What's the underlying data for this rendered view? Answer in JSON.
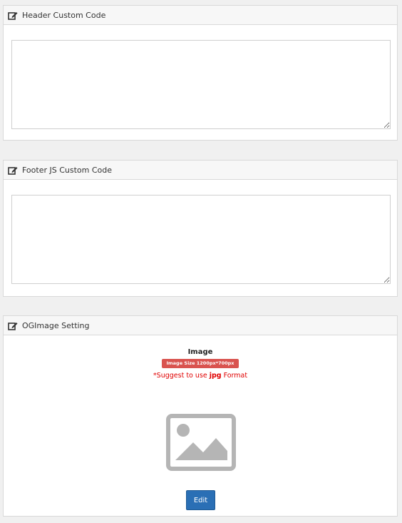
{
  "panels": {
    "header_code": {
      "title": "Header Custom Code",
      "icon": "edit-icon",
      "value": ""
    },
    "footer_code": {
      "title": "Footer JS Custom Code",
      "icon": "edit-icon",
      "value": ""
    },
    "og_image": {
      "title": "OGImage Setting",
      "icon": "edit-icon",
      "image_label": "Image",
      "size_badge": "Image Size 1200px*700px",
      "suggest_prefix": "*Suggest to use ",
      "suggest_format": "jpg",
      "suggest_suffix": " Format",
      "placeholder_icon": "image-placeholder-icon",
      "edit_label": "Edit"
    }
  },
  "colors": {
    "badge": "#d9534f",
    "suggest_text": "#e00000",
    "edit_button": "#2a6fb5",
    "placeholder": "#b5b5b5"
  }
}
